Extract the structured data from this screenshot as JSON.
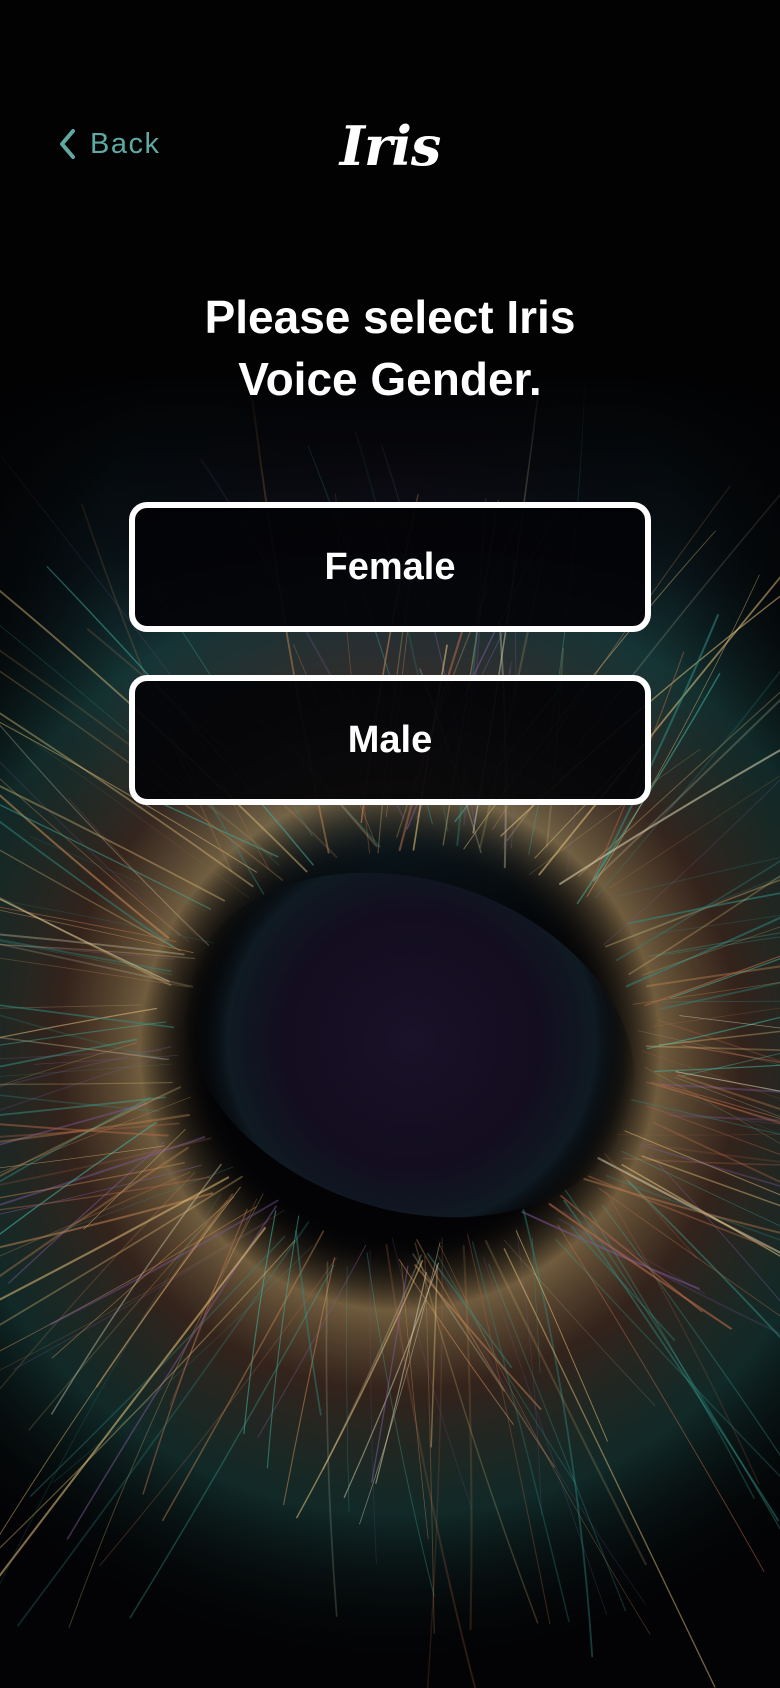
{
  "header": {
    "back_label": "Back",
    "app_title": "Iris"
  },
  "prompt": {
    "line1": "Please select Iris",
    "line2": "Voice Gender."
  },
  "options": [
    {
      "label": "Female"
    },
    {
      "label": "Male"
    }
  ],
  "colors": {
    "background": "#020203",
    "accent": "#5fa9a2",
    "text": "#ffffff",
    "button_border": "#ffffff"
  },
  "icons": {
    "back": "chevron-left-icon",
    "background": "iris-eye-artwork"
  }
}
